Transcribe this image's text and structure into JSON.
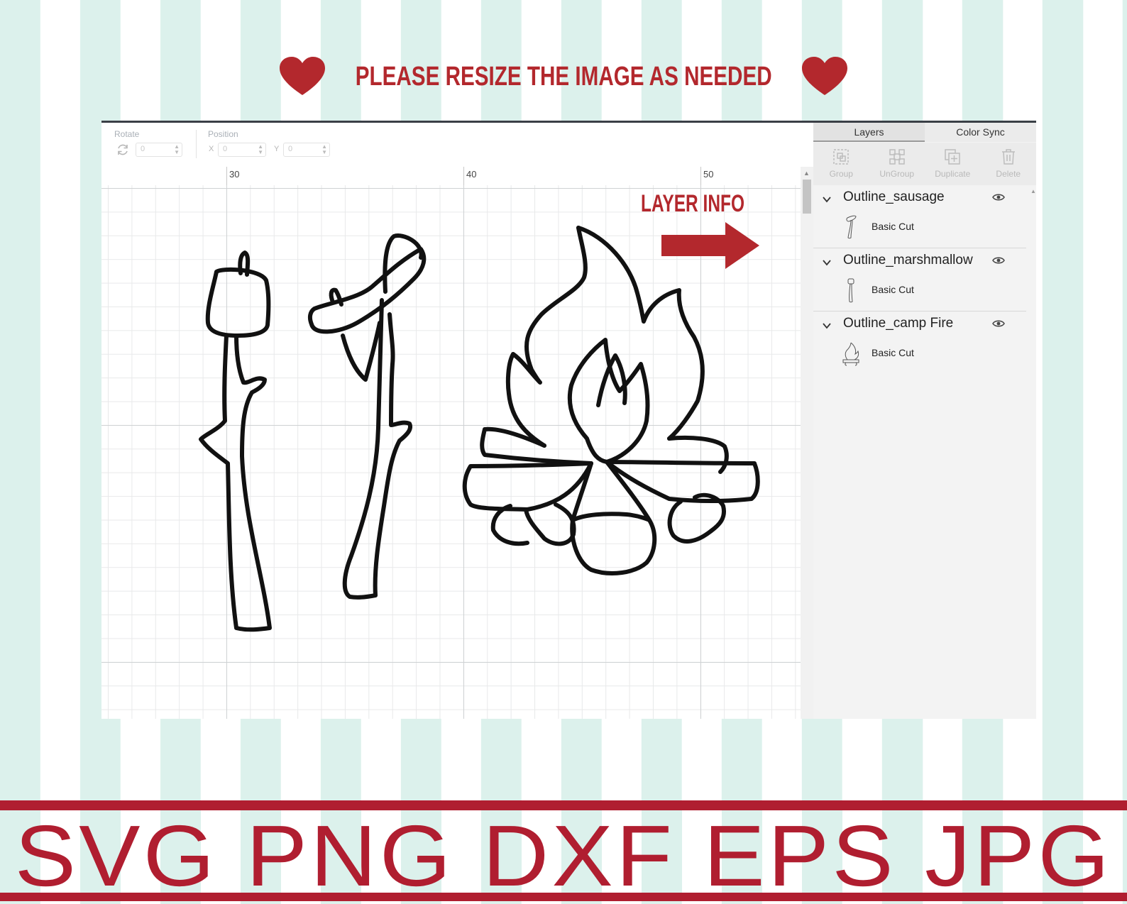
{
  "banner": {
    "text": "PLEASE RESIZE THE IMAGE AS NEEDED"
  },
  "toolbar": {
    "rotate_label": "Rotate",
    "rotate_value": "0",
    "position_label": "Position",
    "x_label": "X",
    "x_value": "0",
    "y_label": "Y",
    "y_value": "0"
  },
  "ruler": {
    "marks": [
      "30",
      "40",
      "50"
    ]
  },
  "callout": {
    "text": "LAYER INFO"
  },
  "panel": {
    "tabs": [
      {
        "label": "Layers",
        "active": true
      },
      {
        "label": "Color Sync",
        "active": false
      }
    ],
    "actions": [
      {
        "label": "Group",
        "icon": "group-icon"
      },
      {
        "label": "UnGroup",
        "icon": "ungroup-icon"
      },
      {
        "label": "Duplicate",
        "icon": "duplicate-icon"
      },
      {
        "label": "Delete",
        "icon": "trash-icon"
      }
    ],
    "layers": [
      {
        "name": "Outline_sausage",
        "operation": "Basic Cut",
        "thumbnail": "sausage-stick-thumbnail"
      },
      {
        "name": "Outline_marshmallow",
        "operation": "Basic Cut",
        "thumbnail": "marshmallow-stick-thumbnail"
      },
      {
        "name": "Outline_camp Fire",
        "operation": "Basic Cut",
        "thumbnail": "campfire-thumbnail"
      }
    ]
  },
  "formats": {
    "text": "SVG  PNG  DXF  EPS  JPG"
  },
  "colors": {
    "accent_red": "#b3282d",
    "band_red": "#b01e30",
    "stripe_mint": "#dcf1ec"
  }
}
